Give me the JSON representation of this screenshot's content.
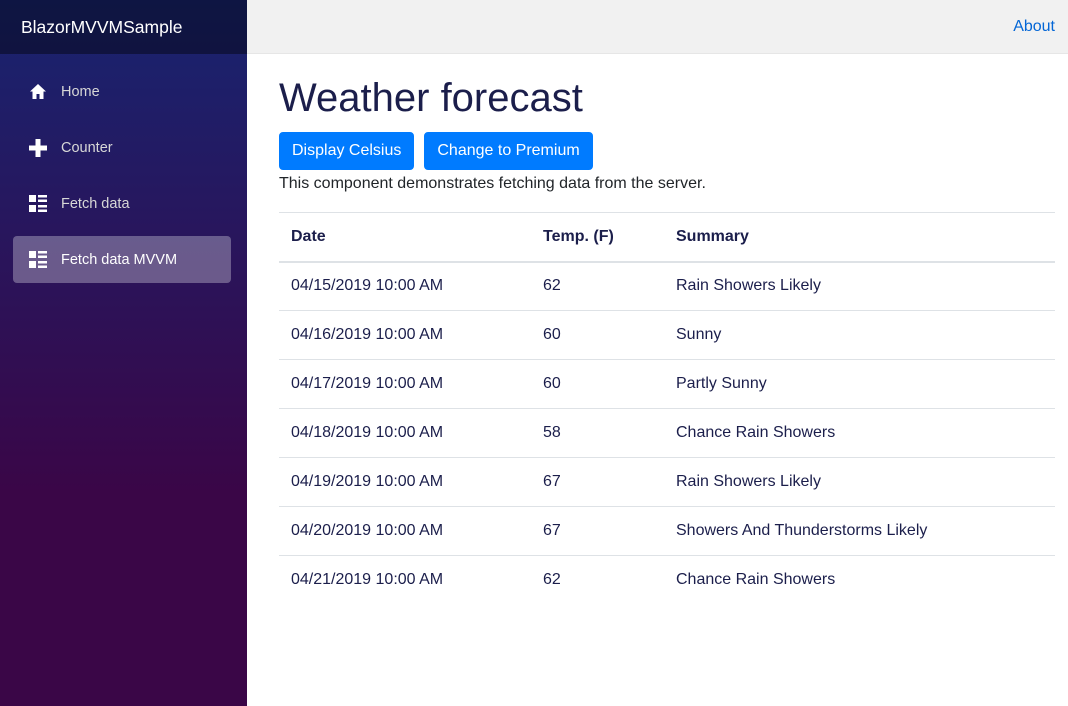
{
  "sidebar": {
    "brand": "BlazorMVVMSample",
    "items": [
      {
        "label": "Home",
        "icon": "home-icon",
        "active": false
      },
      {
        "label": "Counter",
        "icon": "plus-icon",
        "active": false
      },
      {
        "label": "Fetch data",
        "icon": "list-rich-icon",
        "active": false
      },
      {
        "label": "Fetch data MVVM",
        "icon": "list-rich-icon",
        "active": true
      }
    ]
  },
  "header": {
    "about_label": "About"
  },
  "main": {
    "title": "Weather forecast",
    "buttons": {
      "display_celsius": "Display Celsius",
      "change_premium": "Change to Premium"
    },
    "description": "This component demonstrates fetching data from the server.",
    "table": {
      "headers": [
        "Date",
        "Temp. (F)",
        "Summary"
      ],
      "rows": [
        [
          "04/15/2019 10:00 AM",
          "62",
          "Rain Showers Likely"
        ],
        [
          "04/16/2019 10:00 AM",
          "60",
          "Sunny"
        ],
        [
          "04/17/2019 10:00 AM",
          "60",
          "Partly Sunny"
        ],
        [
          "04/18/2019 10:00 AM",
          "58",
          "Chance Rain Showers"
        ],
        [
          "04/19/2019 10:00 AM",
          "67",
          "Rain Showers Likely"
        ],
        [
          "04/20/2019 10:00 AM",
          "67",
          "Showers And Thunderstorms Likely"
        ],
        [
          "04/21/2019 10:00 AM",
          "62",
          "Chance Rain Showers"
        ]
      ]
    }
  },
  "colors": {
    "sidebar_top": "#182470",
    "sidebar_bottom": "#3a0647",
    "button": "#007bff",
    "link": "#0366d6",
    "title": "#1b1e4b"
  }
}
